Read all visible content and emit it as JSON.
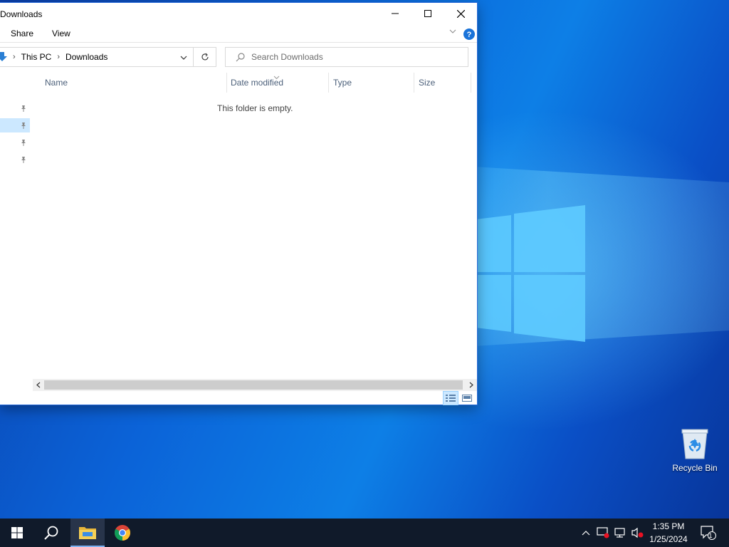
{
  "window": {
    "title": "Downloads",
    "ribbon_tabs": [
      "Share",
      "View"
    ],
    "breadcrumb": [
      "This PC",
      "Downloads"
    ],
    "search_placeholder": "Search Downloads",
    "columns": [
      "Name",
      "Date modified",
      "Type",
      "Size"
    ],
    "empty_message": "This folder is empty."
  },
  "desktop": {
    "recycle_bin_label": "Recycle Bin"
  },
  "taskbar": {
    "time": "1:35 PM",
    "date": "1/25/2024",
    "notification_count": "1"
  },
  "icons": {
    "start": "windows-start-icon",
    "search": "search-icon",
    "explorer": "file-explorer-icon",
    "chrome": "chrome-icon"
  },
  "colors": {
    "accent": "#0078d7",
    "selection": "#cce8ff",
    "taskbar": "#101a2a"
  }
}
